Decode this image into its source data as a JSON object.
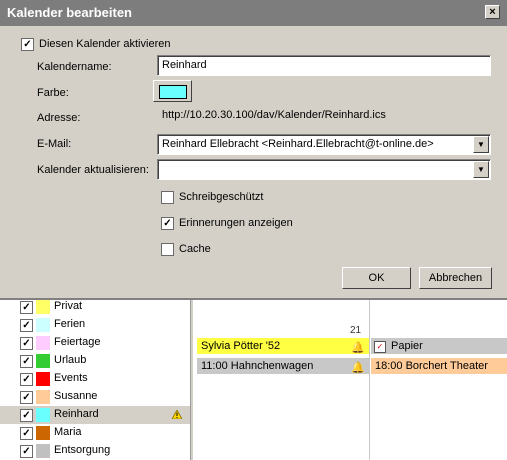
{
  "dialog": {
    "title": "Kalender bearbeiten",
    "close_label": "×",
    "activate": {
      "label": "Diesen Kalender aktivieren",
      "checked": true
    },
    "fields": {
      "name_label": "Kalendername:",
      "name_value": "Reinhard",
      "color_label": "Farbe:",
      "color_value": "#6affff",
      "address_label": "Adresse:",
      "address_value": "http://10.20.30.100/dav/Kalender/Reinhard.ics",
      "email_label": "E-Mail:",
      "email_value": "Reinhard Ellebracht <Reinhard.Ellebracht@t-online.de>",
      "refresh_label": "Kalender aktualisieren:",
      "refresh_value": ""
    },
    "options": {
      "readonly": {
        "label": "Schreibgeschützt",
        "checked": false
      },
      "reminders": {
        "label": "Erinnerungen anzeigen",
        "checked": true
      },
      "cache": {
        "label": "Cache",
        "checked": false
      }
    },
    "ok_label": "OK",
    "cancel_label": "Abbrechen"
  },
  "calendars": [
    {
      "name": "Privat",
      "color": "#ffff66",
      "checked": true,
      "selected": false,
      "warning": false
    },
    {
      "name": "Ferien",
      "color": "#ccffff",
      "checked": true,
      "selected": false,
      "warning": false
    },
    {
      "name": "Feiertage",
      "color": "#ffccff",
      "checked": true,
      "selected": false,
      "warning": false
    },
    {
      "name": "Urlaub",
      "color": "#33cc33",
      "checked": true,
      "selected": false,
      "warning": false
    },
    {
      "name": "Events",
      "color": "#ff0000",
      "checked": true,
      "selected": false,
      "warning": false
    },
    {
      "name": "Susanne",
      "color": "#ffcc99",
      "checked": true,
      "selected": false,
      "warning": false
    },
    {
      "name": "Reinhard",
      "color": "#6affff",
      "checked": true,
      "selected": true,
      "warning": true
    },
    {
      "name": "Maria",
      "color": "#cc6600",
      "checked": true,
      "selected": false,
      "warning": false
    },
    {
      "name": "Entsorgung",
      "color": "#c0c0c0",
      "checked": true,
      "selected": false,
      "warning": false
    }
  ],
  "day_number": "21",
  "events": {
    "birthday": {
      "text": "Sylvia Pötter '52",
      "color": "#ffff44"
    },
    "hahnchen": {
      "text": "11:00 Hahnchenwagen",
      "color": "#c8c8c8"
    },
    "papier": {
      "text": "Papier",
      "color": "#c8c8c8"
    },
    "theater": {
      "text": "18:00 Borchert Theater",
      "color": "#ffcc99"
    }
  }
}
